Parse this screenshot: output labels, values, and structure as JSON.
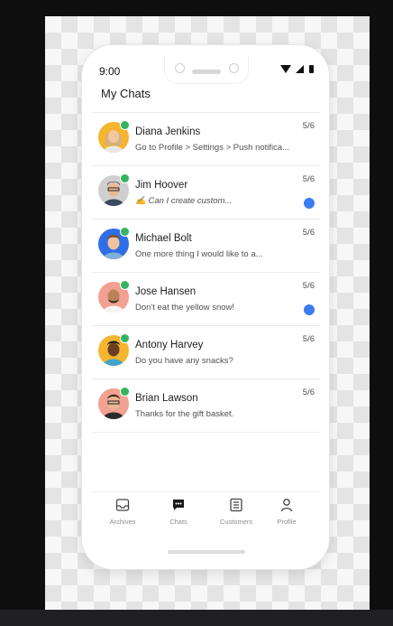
{
  "status": {
    "time": "9:00"
  },
  "header": {
    "title": "My Chats"
  },
  "chats": [
    {
      "name": "Diana Jenkins",
      "preview": "Go to Profile > Settings > Push notifica...",
      "date": "5/6",
      "unread": false,
      "draft": false,
      "avatar_bg": "#f5b52e"
    },
    {
      "name": "Jim Hoover",
      "preview": "✍ Can I create custom...",
      "date": "5/6",
      "unread": true,
      "draft": true,
      "avatar_bg": "#cfcfcf"
    },
    {
      "name": "Michael Bolt",
      "preview": "One more thing I would like to a...",
      "date": "5/6",
      "unread": false,
      "draft": false,
      "avatar_bg": "#2f6ee8"
    },
    {
      "name": "Jose Hansen",
      "preview": "Don't eat the yellow snow!",
      "date": "5/6",
      "unread": true,
      "draft": false,
      "avatar_bg": "#f2a091"
    },
    {
      "name": "Antony Harvey",
      "preview": "Do you have any snacks?",
      "date": "5/6",
      "unread": false,
      "draft": false,
      "avatar_bg": "#f5b52e"
    },
    {
      "name": "Brian Lawson",
      "preview": "Thanks for the gift basket.",
      "date": "5/6",
      "unread": false,
      "draft": false,
      "avatar_bg": "#f2a091"
    }
  ],
  "tabs": [
    {
      "label": "Archives",
      "icon": "archive-icon"
    },
    {
      "label": "Chats",
      "icon": "chat-bubble-icon"
    },
    {
      "label": "Customers",
      "icon": "customers-list-icon"
    },
    {
      "label": "Profile",
      "icon": "person-icon"
    }
  ],
  "colors": {
    "online": "#35b45f",
    "unread": "#3b7cf0"
  }
}
